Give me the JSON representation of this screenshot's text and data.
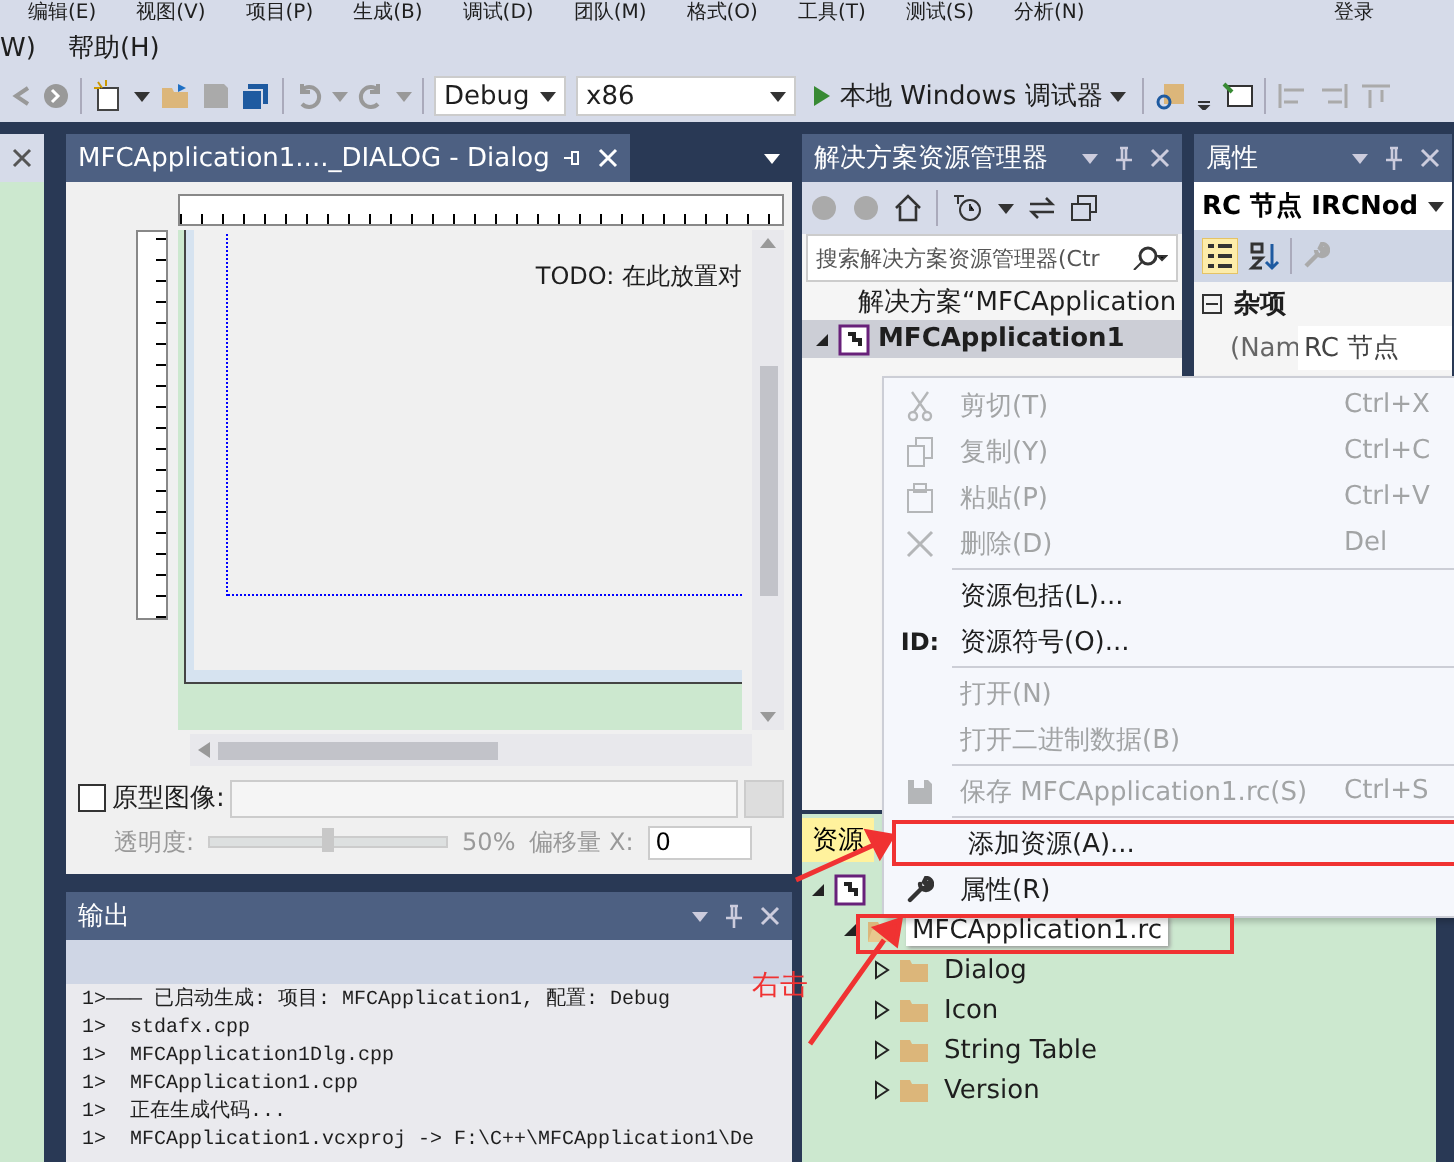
{
  "menu_bar": {
    "row1": [
      "编辑(E)",
      "视图(V)",
      "项目(P)",
      "生成(B)",
      "调试(D)",
      "团队(M)",
      "格式(O)",
      "工具(T)",
      "测试(S)",
      "分析(N)"
    ],
    "account": "登录",
    "row2": [
      "W)",
      "帮助(H)"
    ]
  },
  "toolbar": {
    "configuration": "Debug",
    "platform": "x86",
    "run_button": "本地 Windows 调试器"
  },
  "dialog_editor": {
    "tab": "MFCApplication1...._DIALOG - Dialog",
    "dialog_text": "TODO: 在此放置对",
    "prototype": {
      "label": "原型图像:",
      "checked": false
    },
    "opacity": {
      "label": "透明度:",
      "level": 0.5,
      "reading": "50%"
    },
    "offset": {
      "label": "偏移量 X:",
      "value": "0"
    }
  },
  "output": {
    "title": "输出",
    "lines": [
      "1>——— 已启动生成: 项目: MFCApplication1, 配置: Debug",
      "1>  stdafx.cpp",
      "1>  MFCApplication1Dlg.cpp",
      "1>  MFCApplication1.cpp",
      "1>  正在生成代码...",
      "1>  MFCApplication1.vcxproj -> F:\\C++\\MFCApplication1\\De"
    ]
  },
  "solution_explorer": {
    "title": "解决方案资源管理器",
    "search": {
      "placeholder": "搜索解决方案资源管理器(Ctr"
    },
    "tree": [
      {
        "kind": "solution",
        "label": "解决方案“MFCApplication",
        "selected": false
      },
      {
        "kind": "project",
        "label": "MFCApplication1",
        "selected": true,
        "expanded": true
      }
    ]
  },
  "properties": {
    "title": "属性",
    "object": "RC 节点 IRCNod",
    "category": "杂项",
    "rows": [
      {
        "name": "(Nam",
        "value": "RC 节点"
      }
    ]
  },
  "resource_view": {
    "tab": "资源",
    "tree": [
      {
        "kind": "project",
        "expanded": true,
        "selected": false,
        "children": [
          {
            "kind": "rc",
            "label": "MFCApplication1.rc",
            "expanded": true,
            "selected": true,
            "children": [
              {
                "kind": "folder",
                "label": "Dialog",
                "expanded": false,
                "selected": false
              },
              {
                "kind": "folder",
                "label": "Icon",
                "expanded": false,
                "selected": false
              },
              {
                "kind": "folder",
                "label": "String Table",
                "expanded": false,
                "selected": false
              },
              {
                "kind": "folder",
                "label": "Version",
                "expanded": false,
                "selected": false
              }
            ]
          }
        ]
      }
    ]
  },
  "context_menu": [
    {
      "kind": "item",
      "label": "剪切(T)",
      "shortcut": "Ctrl+X",
      "disabled": true,
      "highlighted": false
    },
    {
      "kind": "item",
      "label": "复制(Y)",
      "shortcut": "Ctrl+C",
      "disabled": true,
      "highlighted": false
    },
    {
      "kind": "item",
      "label": "粘贴(P)",
      "shortcut": "Ctrl+V",
      "disabled": true,
      "highlighted": false
    },
    {
      "kind": "item",
      "label": "删除(D)",
      "shortcut": "Del",
      "disabled": true,
      "highlighted": false
    },
    {
      "kind": "separator"
    },
    {
      "kind": "item",
      "label": "资源包括(L)...",
      "disabled": false,
      "highlighted": false
    },
    {
      "kind": "item",
      "icon_text": "ID:",
      "label": "资源符号(O)...",
      "disabled": false,
      "highlighted": false
    },
    {
      "kind": "separator"
    },
    {
      "kind": "item",
      "label": "打开(N)",
      "disabled": true,
      "highlighted": false
    },
    {
      "kind": "item",
      "label": "打开二进制数据(B)",
      "disabled": true,
      "highlighted": false
    },
    {
      "kind": "separator"
    },
    {
      "kind": "item",
      "label": "保存 MFCApplication1.rc(S)",
      "shortcut": "Ctrl+S",
      "disabled": true,
      "highlighted": false
    },
    {
      "kind": "separator"
    },
    {
      "kind": "item",
      "label": "添加资源(A)...",
      "disabled": false,
      "highlighted": true
    },
    {
      "kind": "item",
      "label": "属性(R)",
      "disabled": false,
      "highlighted": false
    }
  ],
  "annotation": {
    "text": "右击"
  }
}
